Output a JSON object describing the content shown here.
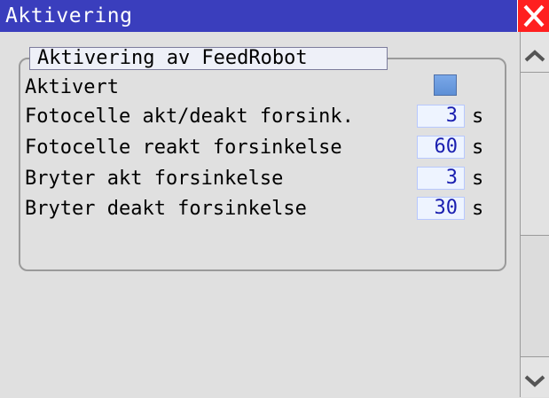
{
  "window": {
    "title": "Aktivering",
    "close_icon": "close-icon",
    "close_color": "#ff1f1f",
    "titlebar_color": "#3a3ebd"
  },
  "group": {
    "title": "Aktivering av FeedRobot"
  },
  "rows": [
    {
      "label": "Aktivert",
      "type": "checkbox",
      "checked": false
    },
    {
      "label": "Fotocelle akt/deakt forsink.",
      "value": "3",
      "unit": "s"
    },
    {
      "label": "Fotocelle reakt forsinkelse",
      "value": "60",
      "unit": "s"
    },
    {
      "label": "Bryter akt forsinkelse",
      "value": "3",
      "unit": "s"
    },
    {
      "label": "Bryter deakt forsinkelse",
      "value": "30",
      "unit": "s"
    }
  ],
  "scrollbar": {
    "up_icon": "chevron-up-icon",
    "down_icon": "chevron-down-icon"
  }
}
